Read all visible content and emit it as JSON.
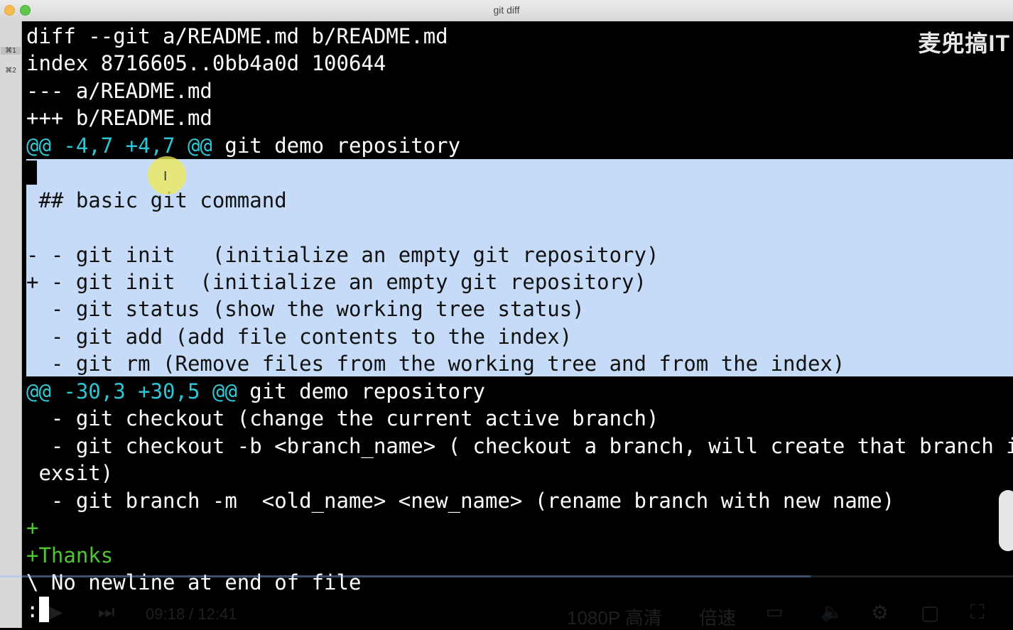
{
  "window": {
    "title": "git diff"
  },
  "tabs": [
    {
      "key": "⌘1",
      "active": true
    },
    {
      "key": "⌘2",
      "active": false
    }
  ],
  "watermark": "麦兜搞IT",
  "diff_header": [
    "diff --git a/README.md b/README.md",
    "index 8716605..0bb4a0d 100644",
    "--- a/README.md",
    "+++ b/README.md"
  ],
  "hunk1": {
    "header": "@@ -4,7 +4,7 @@",
    "context": " git demo repository",
    "lines": [
      "",
      " ## basic git command",
      "",
      "- - git init   (initialize an empty git repository)",
      "+ - git init  (initialize an empty git repository)",
      "  - git status (show the working tree status)",
      "  - git add (add file contents to the index)",
      "  - git rm (Remove files from the working tree and from the index)"
    ]
  },
  "hunk2": {
    "header": "@@ -30,3 +30,5 @@",
    "context": " git demo repository",
    "lines": [
      "  - git checkout (change the current active branch)",
      "  - git checkout -b <branch_name> ( checkout a branch, will create that branch if it c",
      " exsit)",
      "  - git branch -m  <old_name> <new_name> (rename branch with new name)"
    ],
    "added": [
      "+",
      "+Thanks"
    ],
    "no_newline": "\\ No newline at end of file"
  },
  "prompt": ":",
  "player": {
    "time": "09:18 / 12:41",
    "quality": "1080P 高清",
    "speed": "倍速",
    "progress_fraction": 0.8
  },
  "colors": {
    "hunk_header": "#2cc7d6",
    "added": "#4ec531",
    "selection": "#c6dbf7",
    "background": "#000000"
  }
}
